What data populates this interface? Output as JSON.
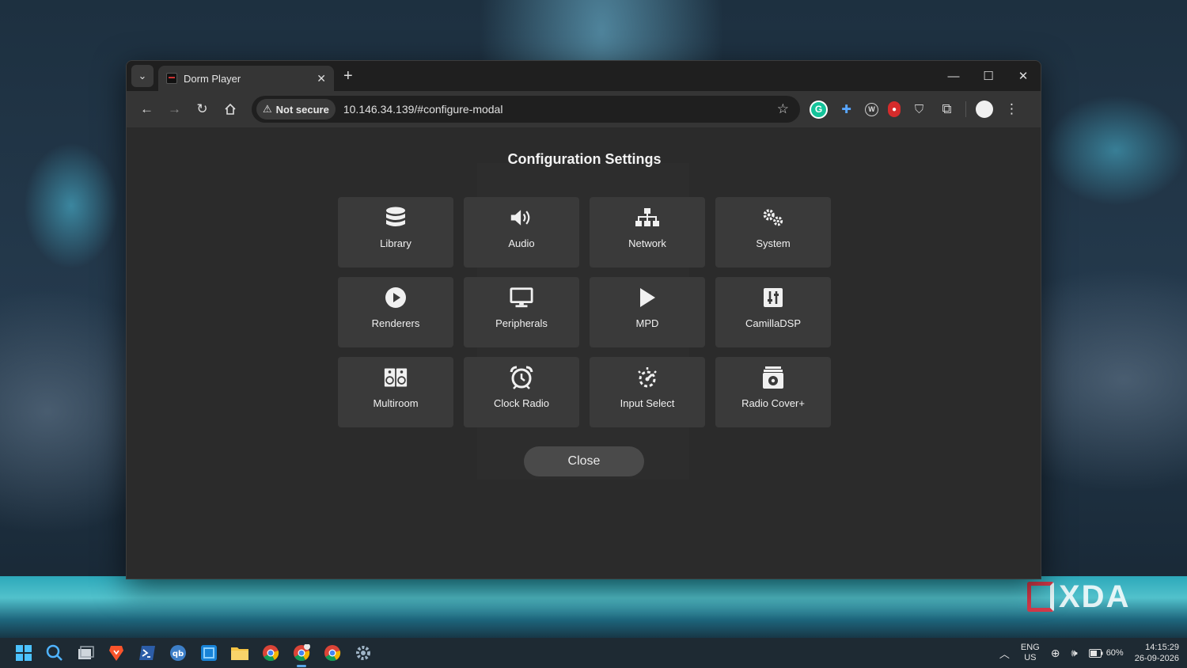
{
  "browser": {
    "tab_title": "Dorm Player",
    "security_label": "Not secure",
    "url": "10.146.34.139/#configure-modal"
  },
  "modal": {
    "title": "Configuration Settings",
    "tiles": [
      {
        "label": "Library",
        "icon": "database-icon"
      },
      {
        "label": "Audio",
        "icon": "volume-icon"
      },
      {
        "label": "Network",
        "icon": "network-icon"
      },
      {
        "label": "System",
        "icon": "gears-icon"
      },
      {
        "label": "Renderers",
        "icon": "play-circle-icon"
      },
      {
        "label": "Peripherals",
        "icon": "monitor-icon"
      },
      {
        "label": "MPD",
        "icon": "play-icon"
      },
      {
        "label": "CamillaDSP",
        "icon": "sliders-icon"
      },
      {
        "label": "Multiroom",
        "icon": "speakers-icon"
      },
      {
        "label": "Clock Radio",
        "icon": "alarm-clock-icon"
      },
      {
        "label": "Input Select",
        "icon": "input-select-icon"
      },
      {
        "label": "Radio Cover+",
        "icon": "radio-cover-icon"
      }
    ],
    "close_label": "Close"
  },
  "watermark": "XDA",
  "taskbar": {
    "lang_top": "ENG",
    "lang_bottom": "US",
    "battery": "60%",
    "time": "14:15:29",
    "date": "26-09-2026"
  }
}
